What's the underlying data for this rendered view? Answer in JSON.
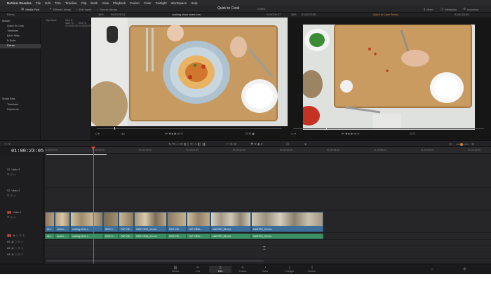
{
  "menubar": {
    "app_name": "DaVinci Resolve",
    "items": [
      "File",
      "Edit",
      "Trim",
      "Timeline",
      "Clip",
      "Mark",
      "View",
      "Playback",
      "Fusion",
      "Color",
      "Fairlight",
      "Workspace",
      "Help"
    ]
  },
  "toolbar": {
    "media_pool": "Media Pool",
    "effects_library": "Effects Library",
    "edit_index": "Edit Index",
    "sound_library": "Sound Library",
    "project_title": "Quick to Cook",
    "project_status": "Edited",
    "mixer": "Mixer",
    "metadata": "Metadata",
    "inspector": "Inspector"
  },
  "subheader": {
    "bin_name": "Extras",
    "zoom_left": "36%",
    "source_tc": "00:00:29:14",
    "clip_name": "cooking show insert.mov",
    "source_tc_right": "01:00:00:07",
    "zoom_right": "36%",
    "program_tc": "01:00:23:05",
    "timeline_name": "Quick to Cook Promo",
    "program_tc_right": "01:00:23:09"
  },
  "media_pool": {
    "master_label": "Master",
    "bins": [
      {
        "label": "Quick to Cook",
        "selected": false
      },
      {
        "label": "Timelines",
        "selected": false
      },
      {
        "label": "B&W Stills",
        "selected": false
      },
      {
        "label": "B-Rolls",
        "selected": false
      },
      {
        "label": "Extras",
        "selected": true
      }
    ],
    "smart_bins_label": "Smart Bins",
    "smart_bins": [
      "Timelines",
      "Keywords"
    ],
    "columns": {
      "clip_name": "Clip Name",
      "reel_name": "Reel N",
      "start_tc": "Start TC",
      "start_value": "01:00:00:00",
      "end_tc": "End TC",
      "end_value": "01:00:00:00"
    }
  },
  "timeline": {
    "current_tc": "01:00:23:05",
    "ruler_marks": [
      "01:00:00:00",
      "01:00:08:00",
      "01:00:16:00",
      "01:00:24:00",
      "01:00:32:00",
      "01:00:40:00",
      "01:00:48:00",
      "01:00:56:00",
      "01:01:04:00",
      "01:01:12:00"
    ],
    "video_tracks": [
      {
        "id": "V3",
        "name": "Video 3"
      },
      {
        "id": "V2",
        "name": "Video 2"
      },
      {
        "id": "V1",
        "name": "Video 1"
      }
    ],
    "audio_tracks": [
      "A1",
      "A2",
      "A3",
      "A4"
    ],
    "video_clips": [
      {
        "label": "AN...",
        "tone": "#3f72a0"
      },
      {
        "label": "cookin...",
        "tone": "#3b6d99"
      },
      {
        "label": "cooking show i...",
        "tone": "#3d6f9a"
      },
      {
        "label": "SIDE V...",
        "tone": "#3b6c98"
      },
      {
        "label": "TOP VIE...",
        "tone": "#3a6b96"
      },
      {
        "label": "SIDE VIEW_01.mov",
        "tone": "#3d6f9a"
      },
      {
        "label": "SIDE VIE...",
        "tone": "#3b6c98"
      },
      {
        "label": "TOP VIEW...",
        "tone": "#3d6f9a"
      },
      {
        "label": "MASTER_08.mov",
        "tone": "#3e709c"
      },
      {
        "label": "MASTER_03.mov",
        "tone": "#3d6f9a"
      }
    ],
    "audio_clips": [
      {
        "label": "AN..."
      },
      {
        "label": "cookin..."
      },
      {
        "label": "cooking show i..."
      },
      {
        "label": "SIDE V..."
      },
      {
        "label": "TOP VIE..."
      },
      {
        "label": "SIDE VIEW_01.mov"
      },
      {
        "label": "SIDE VIE..."
      },
      {
        "label": "TOP VIEW..."
      },
      {
        "label": "MASTER_08.mov"
      },
      {
        "label": "MASTER_03.mov"
      }
    ]
  },
  "pages": [
    {
      "label": "Media",
      "icon": "media-icon",
      "active": false
    },
    {
      "label": "Cut",
      "icon": "cut-icon",
      "active": false
    },
    {
      "label": "Edit",
      "icon": "edit-icon",
      "active": true
    },
    {
      "label": "Fusion",
      "icon": "fusion-icon",
      "active": false
    },
    {
      "label": "Color",
      "icon": "color-icon",
      "active": false
    },
    {
      "label": "Fairlight",
      "icon": "fairlight-icon",
      "active": false
    },
    {
      "label": "Deliver",
      "icon": "deliver-icon",
      "active": false
    }
  ],
  "colors": {
    "playhead": "#e0463a",
    "video_clip": "#3d6f9a",
    "audio_clip": "#3c8f63",
    "accent_orange": "#e48a3a"
  }
}
